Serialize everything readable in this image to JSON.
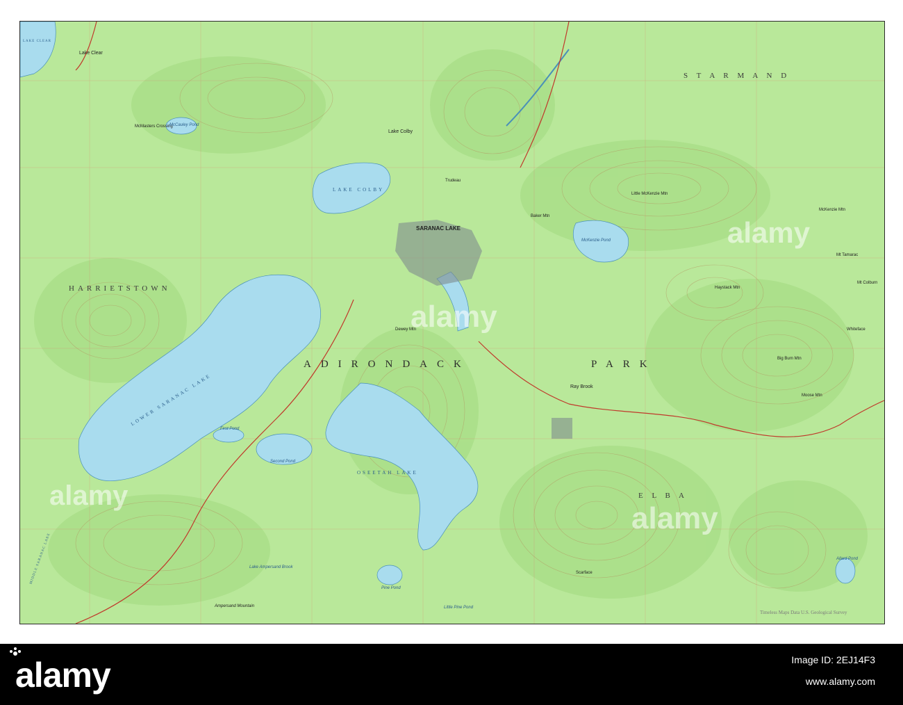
{
  "map": {
    "colors": {
      "land": "#b9e89a",
      "woods": "#a7df86",
      "water": "#a9dcee",
      "contour": "#b48a5a",
      "road": "#c0392b",
      "grid": "#e07a6a",
      "town": "#7f8c8d"
    },
    "regions": {
      "harrietstown": "HARRIETSTOWN",
      "st_armand": "S T   A R M A N D",
      "adirondack": "ADIRONDACK",
      "park": "PARK",
      "elba": "E L B A"
    },
    "towns": {
      "lake_clear": "Lake Clear",
      "saranac_lake": "SARANAC LAKE",
      "lake_colby": "Lake Colby",
      "ray_brook": "Ray Brook",
      "whiteface": "Whiteface",
      "trudeau": "Trudeau",
      "mcmasters": "McMasters Crossing"
    },
    "water": {
      "mccauley_pond": "McCauley Pond",
      "lake_colby_name": "LAKE COLBY",
      "lower_saranac": "LOWER SARANAC LAKE",
      "oseetah_lake": "OSEETAH LAKE",
      "mckenzie_pond": "McKenzie Pond",
      "first_pond": "First Pond",
      "second_pond": "Second Pond",
      "pine_pond": "Pine Pond",
      "little_pine_pond": "Little Pine Pond",
      "lake_ampersand": "Lake Ampersand Brook",
      "allard_pond": "Allard Pond",
      "lake_clear_label": "LAKE CLEAR",
      "middle_saranac": "MIDDLE SARANAC LAKE"
    },
    "peaks": {
      "scarface": "Scarface",
      "ampersand": "Ampersand Mountain",
      "baker_mtn": "Baker Mtn",
      "big_burn": "Big Burn Mtn",
      "mt_colburn": "Mt Colburn",
      "mt_tamarac": "Mt Tamarac",
      "dewey_mtn": "Dewey Mtn",
      "haystack": "Haystack Mtn",
      "little_mckenzie": "Little McKenzie Mtn",
      "mckenzie_mtn": "McKenzie Mtn",
      "moose_mtn": "Moose Mtn"
    },
    "copyright": "Timeless Maps Data U.S. Geological Survey",
    "watermark": "alamy"
  },
  "footer": {
    "logo": "alamy",
    "image_id": "Image ID: 2EJ14F3",
    "url": "www.alamy.com"
  }
}
